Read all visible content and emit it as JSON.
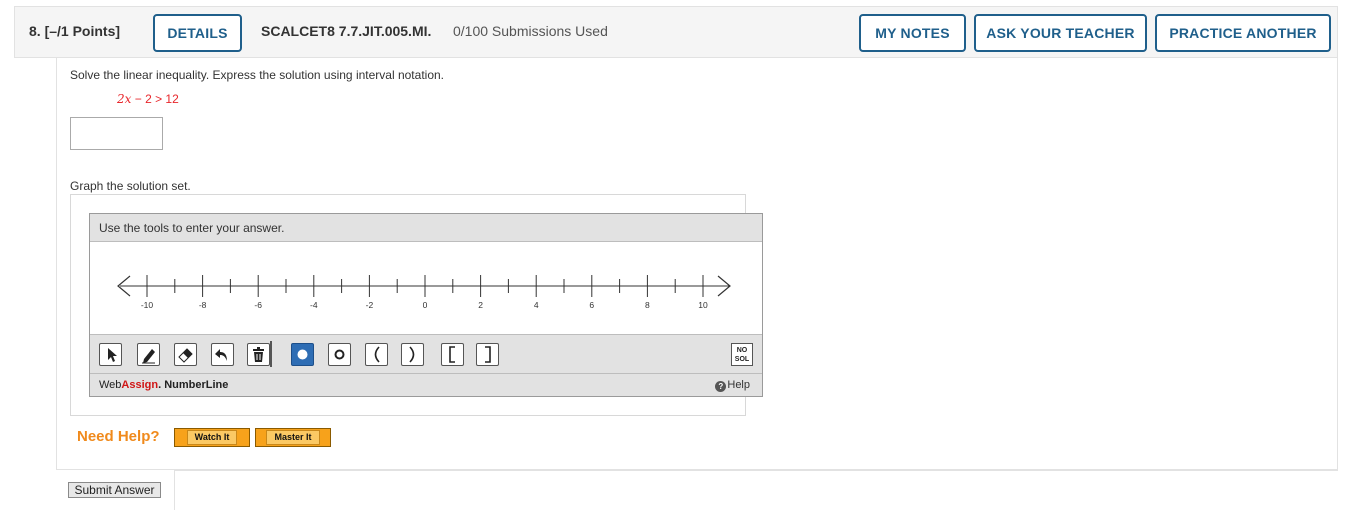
{
  "header": {
    "question_number": "8.",
    "points": "[–/1 Points]",
    "details_label": "DETAILS",
    "question_code": "SCALCET8 7.7.JIT.005.MI.",
    "submissions": "0/100 Submissions Used",
    "my_notes_label": "MY NOTES",
    "ask_teacher_label": "ASK YOUR TEACHER",
    "practice_another_label": "PRACTICE ANOTHER"
  },
  "question": {
    "instruction": "Solve the linear inequality. Express the solution using interval notation.",
    "inequality_var": "2x",
    "inequality_rest": " − 2 > 12",
    "answer_value": "",
    "graph_instruction": "Graph the solution set."
  },
  "numberline": {
    "prompt": "Use the tools to enter your answer.",
    "tick_labels": [
      "-10",
      "-8",
      "-6",
      "-4",
      "-2",
      "0",
      "2",
      "4",
      "6",
      "8",
      "10"
    ],
    "xmin": -11,
    "xmax": 11,
    "tools": [
      "pointer-icon",
      "pencil-icon",
      "eraser-icon",
      "undo-icon",
      "trash-icon",
      "closed-point-icon",
      "open-point-icon",
      "left-paren-icon",
      "right-paren-icon",
      "left-bracket-icon",
      "right-bracket-icon"
    ],
    "selected_tool": "closed-point-icon",
    "no_solution_line1": "NO",
    "no_solution_line2": "SOL",
    "brand_web": "Web",
    "brand_assign": "Assign",
    "brand_suffix": ". NumberLine",
    "help_label": "Help"
  },
  "help": {
    "need_help": "Need Help?",
    "watch_it": "Watch It",
    "master_it": "Master It"
  },
  "submit_label": "Submit Answer",
  "colors": {
    "accent": "#1f5f8b",
    "inequality": "#e8262b",
    "need_help": "#f08a1c",
    "help_button": "#f7a21b",
    "selected_tool": "#2e6db4"
  }
}
